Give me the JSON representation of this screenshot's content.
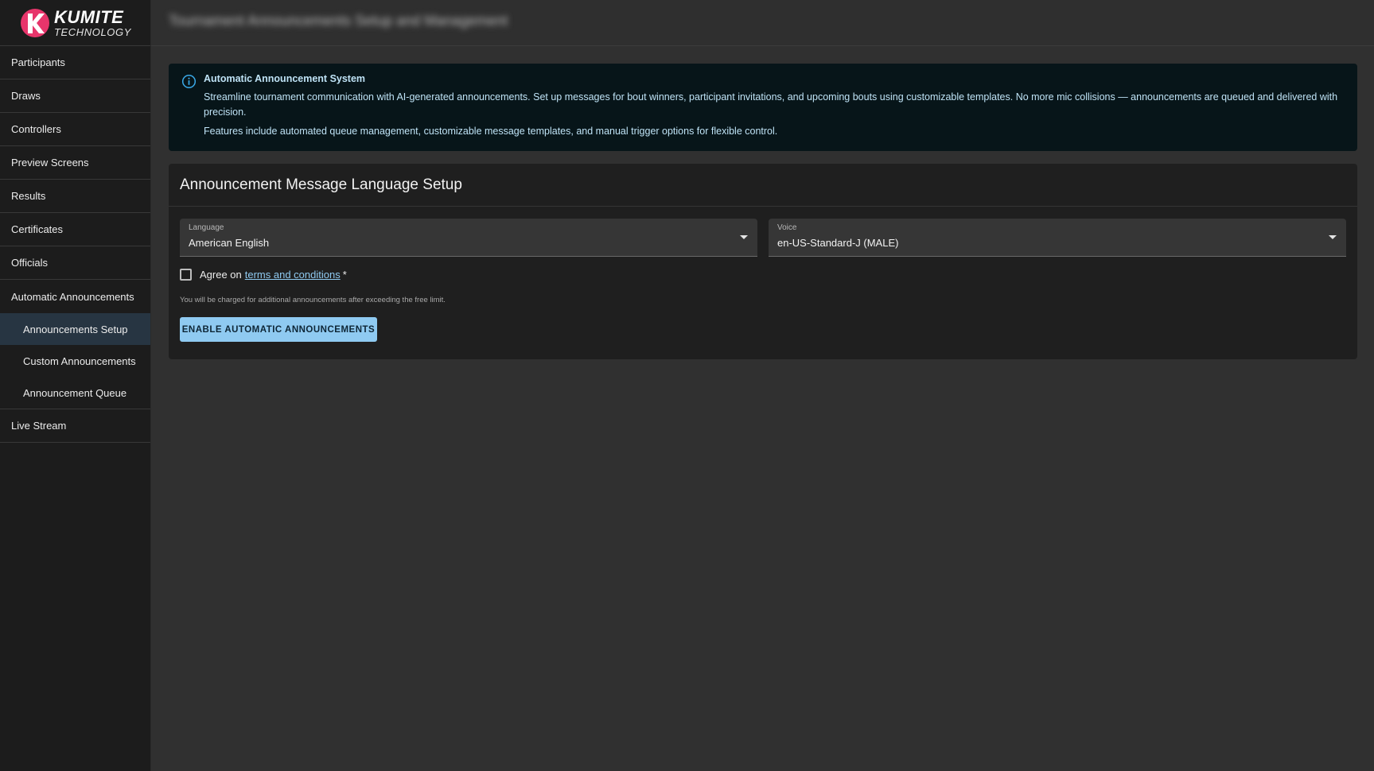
{
  "brand": {
    "title": "KUMITE",
    "subtitle": "TECHNOLOGY",
    "accent_color": "#e7356b"
  },
  "topbar": {
    "title": "Tournament Announcements Setup and Management"
  },
  "sidebar": {
    "items": [
      {
        "label": "Participants"
      },
      {
        "label": "Draws"
      },
      {
        "label": "Controllers"
      },
      {
        "label": "Preview Screens"
      },
      {
        "label": "Results"
      },
      {
        "label": "Certificates"
      },
      {
        "label": "Officials"
      },
      {
        "label": "Automatic Announcements"
      },
      {
        "label": "Live Stream"
      }
    ],
    "sub_items": [
      {
        "label": "Announcements Setup",
        "active": true
      },
      {
        "label": "Custom Announcements",
        "active": false
      },
      {
        "label": "Announcement Queue",
        "active": false
      }
    ]
  },
  "alert": {
    "icon": "info-icon",
    "title": "Automatic Announcement System",
    "text1": "Streamline tournament communication with AI-generated announcements. Set up messages for bout winners, participant invitations, and upcoming bouts using customizable templates. No more mic collisions — announcements are queued and delivered with precision.",
    "text2": "Features include automated queue management, customizable message templates, and manual trigger options for flexible control."
  },
  "setup": {
    "title": "Announcement Message Language Setup",
    "language": {
      "label": "Language",
      "value": "American English"
    },
    "voice": {
      "label": "Voice",
      "value": "en-US-Standard-J (MALE)"
    },
    "agree_prefix": "Agree on",
    "terms_link": "terms and conditions",
    "required_mark": "*",
    "hint": "You will be charged for additional announcements after exceeding the free limit.",
    "enable_button": "ENABLE AUTOMATIC ANNOUNCEMENTS"
  }
}
